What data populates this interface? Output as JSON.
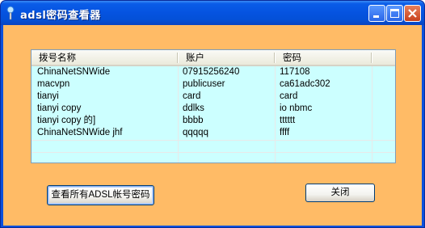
{
  "window": {
    "title": "adsl密码查看器"
  },
  "colors": {
    "client_bg": "#ffbb66",
    "list_bg": "#ccffff",
    "titlebar": "#0553e0"
  },
  "list": {
    "columns": [
      "拨号名称",
      "账户",
      "密码"
    ],
    "rows": [
      [
        "ChinaNetSNWide",
        "07915256240",
        "117108"
      ],
      [
        "macvpn",
        "publicuser",
        "ca61adc302"
      ],
      [
        "tianyi",
        "card",
        "card"
      ],
      [
        "tianyi copy",
        "ddlks",
        "io nbmc"
      ],
      [
        "tianyi copy 的]",
        "bbbb",
        "tttttt"
      ],
      [
        "ChinaNetSNWide jhf",
        "qqqqq",
        "ffff"
      ]
    ]
  },
  "buttons": {
    "show_all": "查看所有ADSL帐号密码",
    "close": "关闭"
  }
}
